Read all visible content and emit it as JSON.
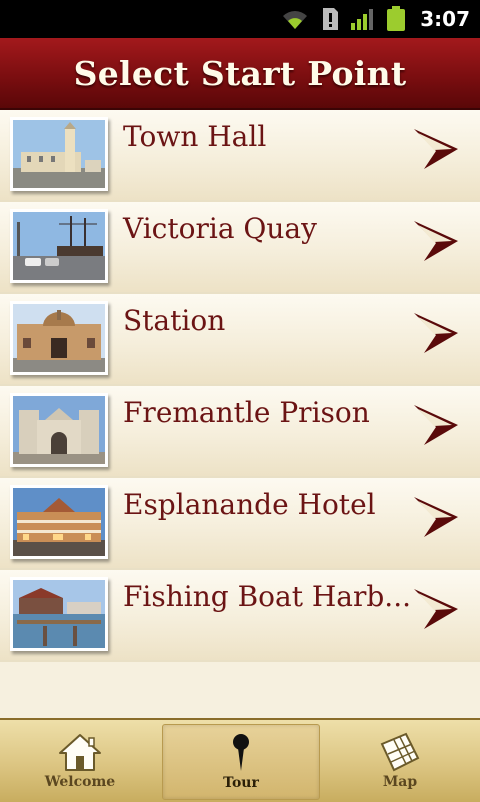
{
  "status_bar": {
    "time": "3:07"
  },
  "header": {
    "title": "Select Start Point"
  },
  "locations": [
    {
      "label": "Town Hall",
      "icon": "town-hall-photo"
    },
    {
      "label": "Victoria Quay",
      "icon": "victoria-quay-photo"
    },
    {
      "label": "Station",
      "icon": "station-photo"
    },
    {
      "label": "Fremantle Prison",
      "icon": "fremantle-prison-photo"
    },
    {
      "label": "Esplanande Hotel",
      "icon": "esplanande-hotel-photo"
    },
    {
      "label": "Fishing Boat Harb...",
      "icon": "fishing-boat-harbour-photo"
    }
  ],
  "bottom_nav": {
    "items": [
      {
        "label": "Welcome",
        "icon": "home-icon"
      },
      {
        "label": "Tour",
        "icon": "pin-icon",
        "active": true
      },
      {
        "label": "Map",
        "icon": "map-icon"
      }
    ]
  },
  "colors": {
    "title_bar": "#8b1214",
    "label_text": "#6b1414",
    "arrow": "#5a0a0a",
    "nav_bg": "#dcc582"
  }
}
